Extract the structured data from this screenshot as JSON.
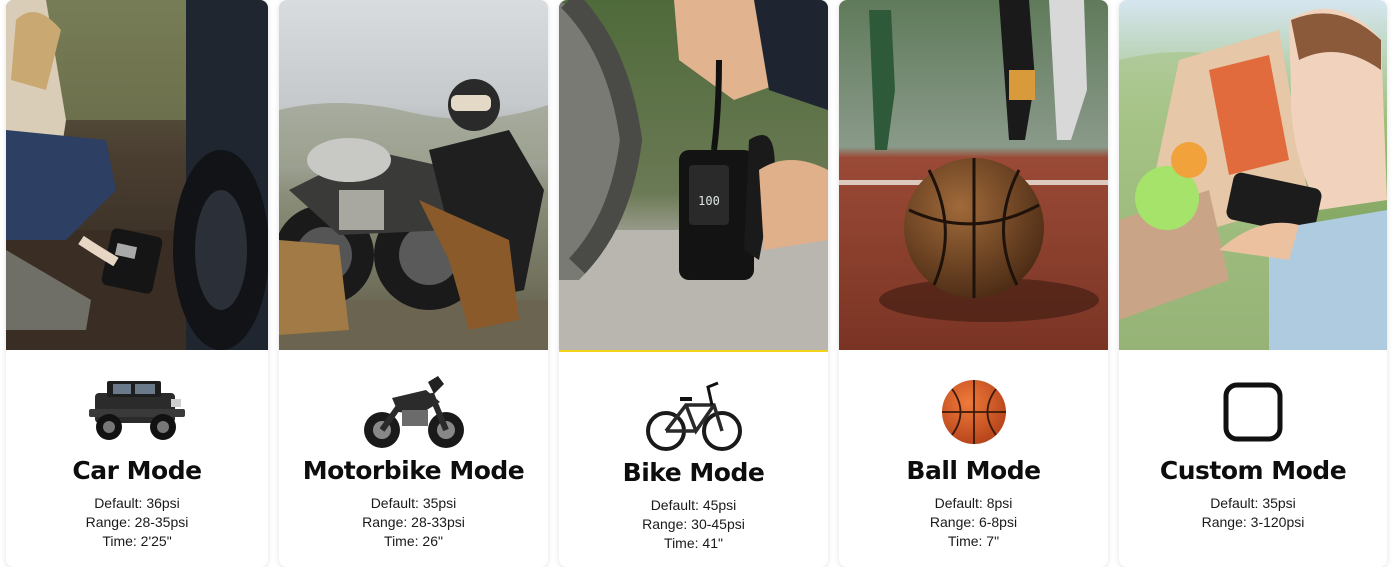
{
  "modes": [
    {
      "title": "Car Mode",
      "icon": "jeep-car-icon",
      "default": "Default: 36psi",
      "range": "Range: 28-35psi",
      "time": "Time: 2'25\""
    },
    {
      "title": "Motorbike Mode",
      "icon": "motorbike-icon",
      "default": "Default: 35psi",
      "range": "Range: 28-33psi",
      "time": "Time: 26\""
    },
    {
      "title": "Bike Mode",
      "icon": "bicycle-icon",
      "default": "Default: 45psi",
      "range": "Range: 30-45psi",
      "time": "Time: 41\""
    },
    {
      "title": "Ball Mode",
      "icon": "basketball-icon",
      "default": "Default: 8psi",
      "range": "Range: 6-8psi",
      "time": "Time: 7\""
    },
    {
      "title": "Custom Mode",
      "icon": "rounded-square-icon",
      "default": "Default: 35psi",
      "range": "Range: 3-120psi"
    }
  ],
  "colors": {
    "accent_border": "#f2d21a",
    "title_text": "#0d0d0d",
    "card_background": "#ffffff"
  }
}
